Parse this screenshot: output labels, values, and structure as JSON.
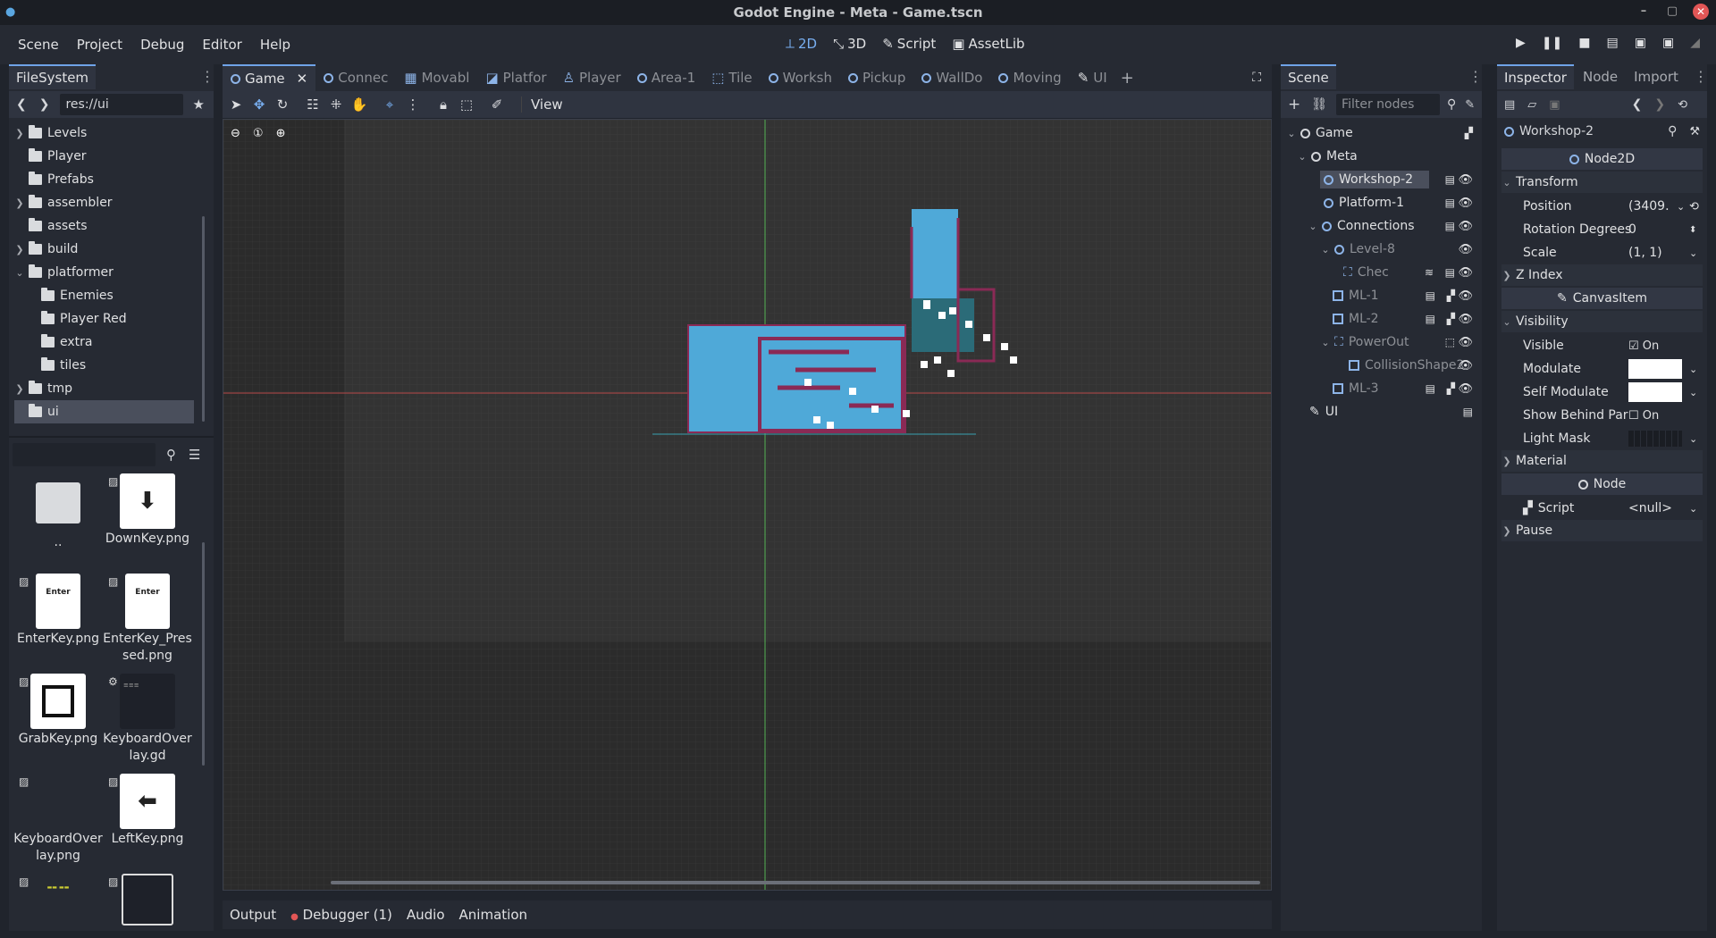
{
  "window": {
    "title": "Godot Engine - Meta - Game.tscn"
  },
  "menu": [
    "Scene",
    "Project",
    "Debug",
    "Editor",
    "Help"
  ],
  "workspaces": [
    {
      "label": "2D",
      "icon": "2d-icon"
    },
    {
      "label": "3D",
      "icon": "3d-icon"
    },
    {
      "label": "Script",
      "icon": "script-icon"
    },
    {
      "label": "AssetLib",
      "icon": "assetlib-icon"
    }
  ],
  "filesystem": {
    "tab": "FileSystem",
    "path": "res://ui",
    "tree": [
      {
        "label": "Levels",
        "expandable": true
      },
      {
        "label": "Player",
        "expandable": false
      },
      {
        "label": "Prefabs",
        "expandable": false
      },
      {
        "label": "assembler",
        "expandable": true
      },
      {
        "label": "assets",
        "expandable": false
      },
      {
        "label": "build",
        "expandable": true
      },
      {
        "label": "platformer",
        "expandable": true,
        "expanded": true
      },
      {
        "label": "Enemies",
        "indent": true
      },
      {
        "label": "Player Red",
        "indent": true
      },
      {
        "label": "extra",
        "indent": true
      },
      {
        "label": "tiles",
        "indent": true
      },
      {
        "label": "tmp",
        "expandable": true
      },
      {
        "label": "ui",
        "selected": true
      }
    ],
    "files": [
      {
        "name": ".."
      },
      {
        "name": "DownKey.png"
      },
      {
        "name": "EnterKey.png",
        "thumb_text": "Enter"
      },
      {
        "name": "EnterKey_Pressed.png",
        "thumb_text": "Enter"
      },
      {
        "name": "GrabKey.png"
      },
      {
        "name": "KeyboardOverlay.gd"
      },
      {
        "name": "KeyboardOverlay.png"
      },
      {
        "name": "LeftKey.png"
      }
    ]
  },
  "scene_tabs": [
    "Game",
    "Connec",
    "Movabl",
    "Platfor",
    "Player",
    "Area-1",
    "Tile",
    "Worksh",
    "Pickup",
    "WallDo",
    "Moving",
    "UI"
  ],
  "toolbar": {
    "view_label": "View"
  },
  "scene_panel": {
    "tab": "Scene",
    "filter_placeholder": "Filter nodes",
    "nodes": [
      {
        "label": "Game"
      },
      {
        "label": "Meta"
      },
      {
        "label": "Workshop-2",
        "selected": true
      },
      {
        "label": "Platform-1"
      },
      {
        "label": "Connections"
      },
      {
        "label": "Level-8"
      },
      {
        "label": "Chec"
      },
      {
        "label": "ML-1"
      },
      {
        "label": "ML-2"
      },
      {
        "label": "PowerOut"
      },
      {
        "label": "CollisionShape2"
      },
      {
        "label": "ML-3"
      },
      {
        "label": "UI"
      }
    ]
  },
  "inspector": {
    "tabs": [
      "Inspector",
      "Node",
      "Import"
    ],
    "object": "Workshop-2",
    "class_header": "Node2D",
    "transform_label": "Transform",
    "position_label": "Position",
    "position_value": "(3409.",
    "rotation_label": "Rotation Degrees",
    "rotation_value": "0",
    "scale_label": "Scale",
    "scale_value": "(1, 1)",
    "zindex_label": "Z Index",
    "canvasitem_header": "CanvasItem",
    "visibility_label": "Visibility",
    "visible_label": "Visible",
    "visible_value": "On",
    "modulate_label": "Modulate",
    "self_modulate_label": "Self Modulate",
    "show_behind_label": "Show Behind Par",
    "show_behind_value": "On",
    "light_mask_label": "Light Mask",
    "material_label": "Material",
    "node_header": "Node",
    "script_label": "Script",
    "script_value": "<null>",
    "pause_label": "Pause"
  },
  "bottom_tabs": [
    "Output",
    "Debugger (1)",
    "Audio",
    "Animation"
  ]
}
